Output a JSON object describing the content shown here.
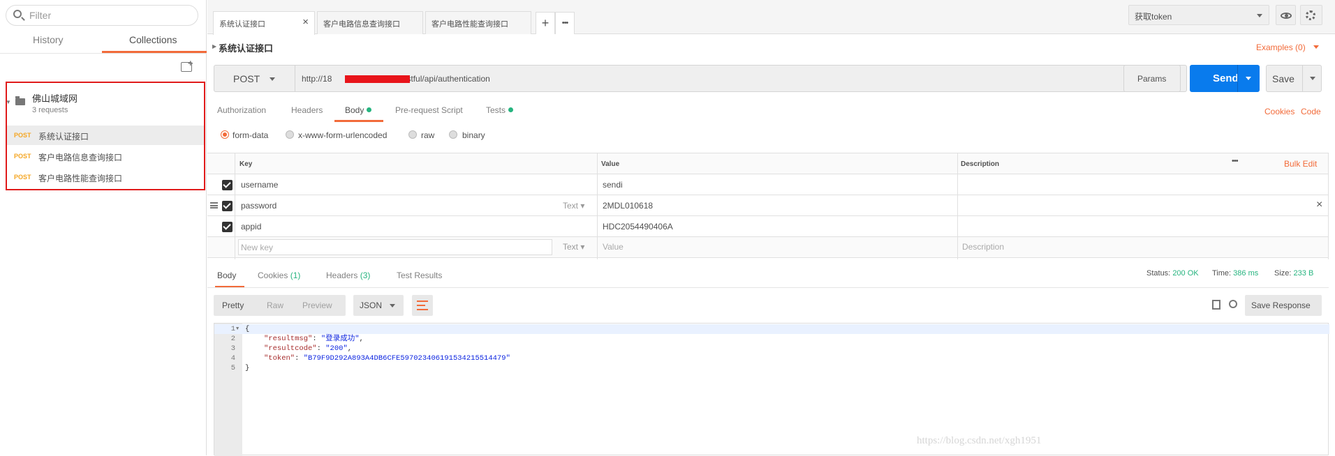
{
  "sidebar": {
    "search_placeholder": "Filter",
    "tabs": [
      {
        "label": "History"
      },
      {
        "label": "Collections"
      }
    ],
    "collection": {
      "name": "佛山城域网",
      "subtitle": "3 requests",
      "requests": [
        {
          "method": "POST",
          "name": "系统认证接口"
        },
        {
          "method": "POST",
          "name": "客户电路信息查询接口"
        },
        {
          "method": "POST",
          "name": "客户电路性能查询接口"
        }
      ]
    }
  },
  "tabs": [
    {
      "label": "系统认证接口"
    },
    {
      "label": "客户电路信息查询接口"
    },
    {
      "label": "客户电路性能查询接口"
    }
  ],
  "toolbar": {
    "plus": "+",
    "more": "•••",
    "environment": "获取token"
  },
  "request": {
    "title": "系统认证接口",
    "examples": "Examples (0)",
    "method": "POST",
    "url_prefix": "http://18",
    "url_suffix": "/restful/api/authentication",
    "params_label": "Params",
    "send_label": "Send",
    "save_label": "Save"
  },
  "subtabs": {
    "authorization": "Authorization",
    "headers": "Headers",
    "body": "Body",
    "prerequest": "Pre-request Script",
    "tests": "Tests",
    "cookies": "Cookies",
    "code": "Code"
  },
  "body_modes": {
    "form_data": "form-data",
    "urlencoded": "x-www-form-urlencoded",
    "raw": "raw",
    "binary": "binary"
  },
  "table": {
    "headers": {
      "key": "Key",
      "value": "Value",
      "description": "Description"
    },
    "more": "•••",
    "bulk_edit": "Bulk Edit",
    "rows": [
      {
        "key": "username",
        "value": "sendi",
        "checked": true
      },
      {
        "key": "password",
        "value": "2MDL010618",
        "type": "Text",
        "checked": true
      },
      {
        "key": "appid",
        "value": "HDC2054490406A",
        "checked": true
      }
    ],
    "new_row": {
      "key": "New key",
      "type": "Text",
      "value": "Value",
      "description": "Description"
    },
    "delete_icon": "×"
  },
  "response": {
    "tabs": {
      "body": "Body",
      "cookies": "Cookies",
      "cookies_count": "(1)",
      "headers": "Headers",
      "headers_count": "(3)",
      "test_results": "Test Results"
    },
    "status_label": "Status:",
    "status_value": "200 OK",
    "time_label": "Time:",
    "time_value": "386 ms",
    "size_label": "Size:",
    "size_value": "233 B",
    "view_modes": {
      "pretty": "Pretty",
      "raw": "Raw",
      "preview": "Preview"
    },
    "format": "JSON",
    "save_response": "Save Response",
    "code_lines": [
      {
        "n": "1",
        "text": "{"
      },
      {
        "n": "2",
        "key": "\"resultmsg\"",
        "val": "\"登录成功\""
      },
      {
        "n": "3",
        "key": "\"resultcode\"",
        "val": "\"200\""
      },
      {
        "n": "4",
        "key": "\"token\"",
        "val": "\"B79F9D292A893A4DB6CFE597023406191534215514479\""
      },
      {
        "n": "5",
        "text": "}"
      }
    ]
  },
  "watermark": "https://blog.csdn.net/xgh1951"
}
